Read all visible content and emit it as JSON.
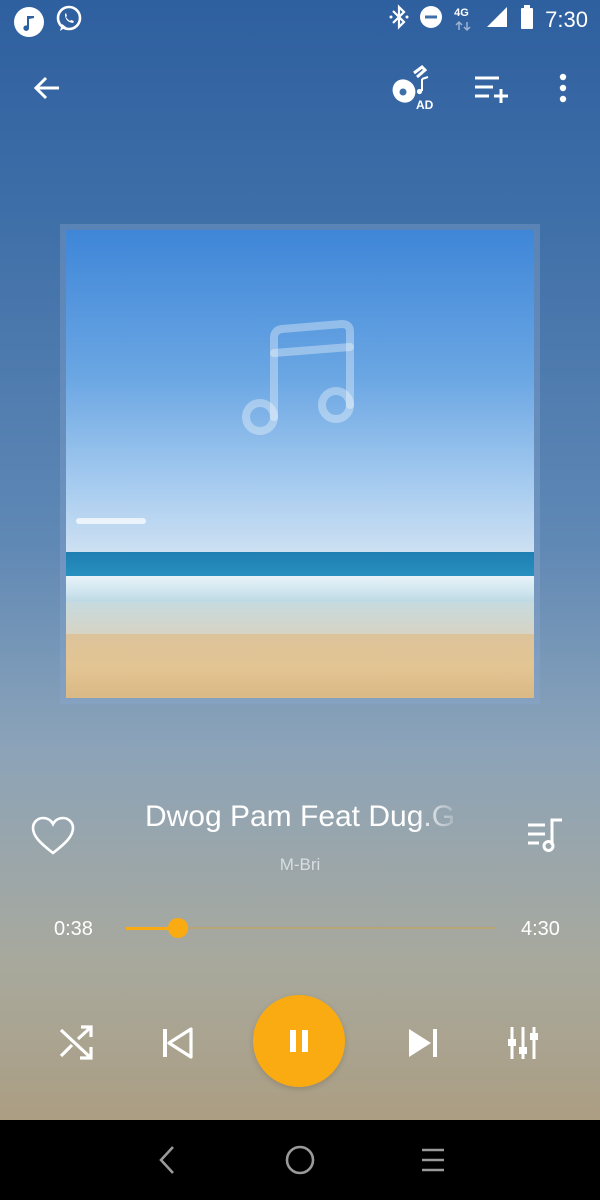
{
  "status_bar": {
    "time": "7:30",
    "network_label": "4G",
    "icons": [
      "music-note-icon",
      "whatsapp-icon",
      "bluetooth-icon",
      "do-not-disturb-icon",
      "signal-icon",
      "battery-icon"
    ]
  },
  "toolbar": {
    "back_icon": "arrow-left-icon",
    "guitar_badge": "AD",
    "add_playlist_icon": "playlist-add-icon",
    "more_icon": "more-vert-icon"
  },
  "track": {
    "title": "Dwog Pam Feat Dug.G",
    "artist": "M-Bri"
  },
  "progress": {
    "elapsed": "0:38",
    "duration": "4:30",
    "fraction": 0.14
  },
  "controls": {
    "shuffle_icon": "shuffle-icon",
    "previous_icon": "skip-previous-icon",
    "pause_icon": "pause-icon",
    "next_icon": "skip-next-icon",
    "equalizer_icon": "equalizer-icon"
  },
  "colors": {
    "accent": "#fbab12",
    "nav_bar": "#000000"
  }
}
